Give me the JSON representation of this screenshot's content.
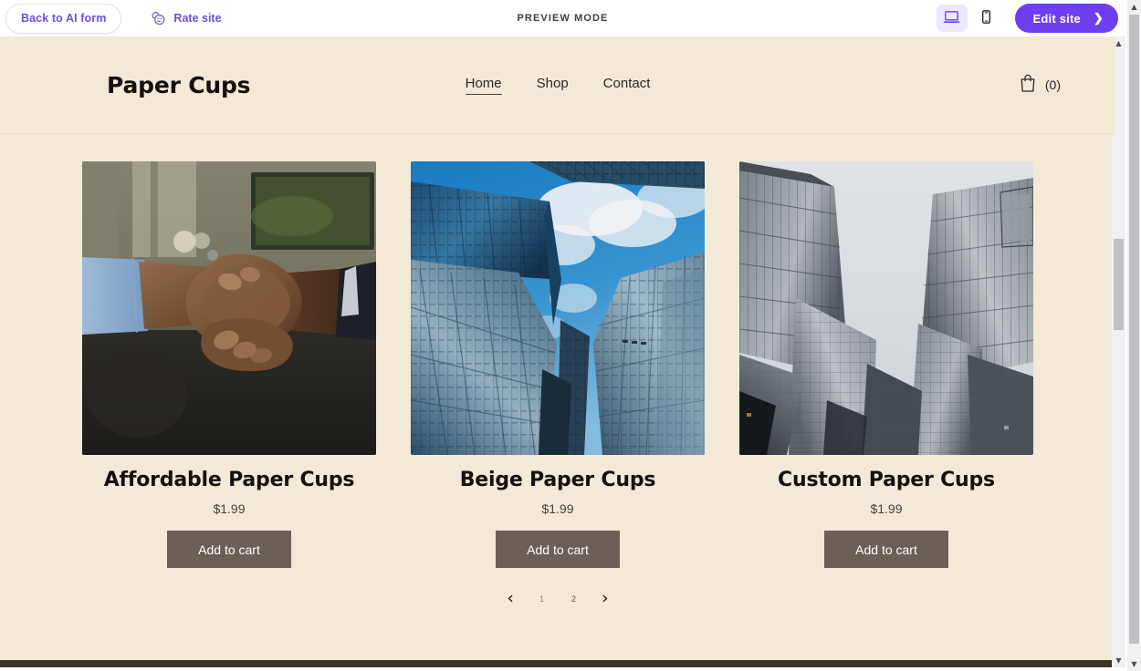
{
  "builder_bar": {
    "back_label": "Back to AI form",
    "rate_label": "Rate site",
    "rate_icon": "smiley-faces-icon",
    "preview_mode_label": "PREVIEW MODE",
    "desktop_icon": "desktop-monitor-icon",
    "mobile_icon": "mobile-phone-icon",
    "active_device": "desktop",
    "edit_label": "Edit site",
    "edit_chevron": "❯",
    "accent_purple": "#6d3ff0",
    "accent_purple_light": "#ece8fd"
  },
  "site": {
    "logo": "Paper Cups",
    "background": "#f2ead7",
    "nav": [
      {
        "label": "Home",
        "active": true
      },
      {
        "label": "Shop",
        "active": false
      },
      {
        "label": "Contact",
        "active": false
      }
    ],
    "cart": {
      "icon": "shopping-bag-icon",
      "count_label": "(0)"
    },
    "products": [
      {
        "title": "Affordable Paper Cups",
        "price": "$1.99",
        "button_label": "Add to cart",
        "image_alt": "business-handshake-photo"
      },
      {
        "title": "Beige Paper Cups",
        "price": "$1.99",
        "button_label": "Add to cart",
        "image_alt": "blue-sky-glass-skyscrapers-photo"
      },
      {
        "title": "Custom Paper Cups",
        "price": "$1.99",
        "button_label": "Add to cart",
        "image_alt": "monochrome-glass-buildings-photo"
      }
    ],
    "pagination": {
      "prev_icon": "‹",
      "next_icon": "›",
      "pages": [
        {
          "label": "1",
          "active": true
        },
        {
          "label": "2",
          "active": false
        }
      ]
    },
    "button_color": "#6b6057",
    "footer_color": "#3e3228"
  }
}
